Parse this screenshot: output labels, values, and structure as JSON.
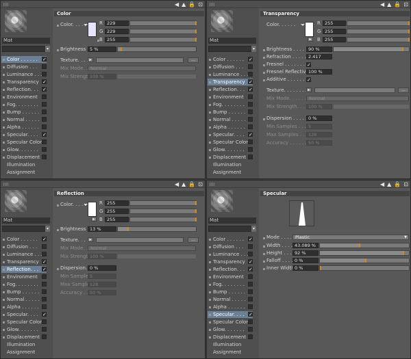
{
  "panels": [
    {
      "id": "color",
      "material_name": "Mat",
      "section_title": "Color",
      "selected_channel": 0,
      "channels": [
        {
          "label": "Color . . . . . .",
          "checked": true
        },
        {
          "label": "Diffusion . . .",
          "checked": false
        },
        {
          "label": "Luminance . . .",
          "checked": false
        },
        {
          "label": "Transparency",
          "checked": true
        },
        {
          "label": "Reflection. . .",
          "checked": true
        },
        {
          "label": "Environment",
          "checked": false
        },
        {
          "label": "Fog. . . . . . . .",
          "checked": false
        },
        {
          "label": "Bump . . . . . .",
          "checked": false
        },
        {
          "label": "Normal . . . . .",
          "checked": false
        },
        {
          "label": "Alpha . . . . . .",
          "checked": false
        },
        {
          "label": "Specular. . . .",
          "checked": true
        },
        {
          "label": "Specular Color",
          "checked": false
        },
        {
          "label": "Glow. . . . . . .",
          "checked": false
        },
        {
          "label": "Displacement",
          "checked": false
        },
        {
          "label": "Illumination",
          "checked": null
        },
        {
          "label": "Assignment",
          "checked": null
        }
      ]
    },
    {
      "id": "transparency",
      "material_name": "Mat",
      "section_title": "Transparency",
      "selected_channel": 3,
      "channels": [
        {
          "label": "Color . . . . . .",
          "checked": true
        },
        {
          "label": "Diffusion . . .",
          "checked": false
        },
        {
          "label": "Luminance . . .",
          "checked": false
        },
        {
          "label": "Transparency",
          "checked": true
        },
        {
          "label": "Reflection. . .",
          "checked": true
        },
        {
          "label": "Environment",
          "checked": false
        },
        {
          "label": "Fog. . . . . . . .",
          "checked": false
        },
        {
          "label": "Bump . . . . . .",
          "checked": false
        },
        {
          "label": "Normal . . . . .",
          "checked": false
        },
        {
          "label": "Alpha . . . . . .",
          "checked": false
        },
        {
          "label": "Specular. . . .",
          "checked": true
        },
        {
          "label": "Specular Color",
          "checked": false
        },
        {
          "label": "Glow. . . . . . .",
          "checked": false
        },
        {
          "label": "Displacement",
          "checked": false
        },
        {
          "label": "Illumination",
          "checked": null
        },
        {
          "label": "Assignment",
          "checked": null
        }
      ]
    },
    {
      "id": "reflection",
      "material_name": "Mat",
      "section_title": "Reflection",
      "selected_channel": 4,
      "channels": [
        {
          "label": "Color . . . . . .",
          "checked": true
        },
        {
          "label": "Diffusion . . .",
          "checked": false
        },
        {
          "label": "Luminance . . .",
          "checked": false
        },
        {
          "label": "Transparency",
          "checked": true
        },
        {
          "label": "Reflection. . .",
          "checked": true
        },
        {
          "label": "Environment",
          "checked": false
        },
        {
          "label": "Fog. . . . . . . .",
          "checked": false
        },
        {
          "label": "Bump . . . . . .",
          "checked": false
        },
        {
          "label": "Normal . . . . .",
          "checked": false
        },
        {
          "label": "Alpha . . . . . .",
          "checked": false
        },
        {
          "label": "Specular. . . .",
          "checked": true
        },
        {
          "label": "Specular Color",
          "checked": false
        },
        {
          "label": "Glow. . . . . . .",
          "checked": false
        },
        {
          "label": "Displacement",
          "checked": false
        },
        {
          "label": "Illumination",
          "checked": null
        },
        {
          "label": "Assignment",
          "checked": null
        }
      ]
    },
    {
      "id": "specular",
      "material_name": "Mat",
      "section_title": "Specular",
      "selected_channel": 10,
      "channels": [
        {
          "label": "Color . . . . . .",
          "checked": true
        },
        {
          "label": "Diffusion . . .",
          "checked": false
        },
        {
          "label": "Luminance . . .",
          "checked": false
        },
        {
          "label": "Transparency",
          "checked": true
        },
        {
          "label": "Reflection. . .",
          "checked": true
        },
        {
          "label": "Environment",
          "checked": false
        },
        {
          "label": "Fog. . . . . . . .",
          "checked": false
        },
        {
          "label": "Bump . . . . . .",
          "checked": false
        },
        {
          "label": "Normal . . . . .",
          "checked": false
        },
        {
          "label": "Alpha . . . . . .",
          "checked": false
        },
        {
          "label": "Specular. . . .",
          "checked": true
        },
        {
          "label": "Specular Color",
          "checked": false
        },
        {
          "label": "Glow. . . . . . .",
          "checked": false
        },
        {
          "label": "Displacement",
          "checked": false
        },
        {
          "label": "Illumination",
          "checked": null
        },
        {
          "label": "Assignment",
          "checked": null
        }
      ]
    }
  ],
  "color": {
    "color_label": "Color. . . . . .",
    "r": "229",
    "g": "229",
    "b": "255",
    "r_level": 0.898,
    "g_level": 0.898,
    "b_level": 1.0,
    "brightness_label": "Brightness",
    "brightness": "5 %",
    "brightness_level": 0.05,
    "texture_label": "Texture. . . . .",
    "mixmode_label": "Mix Mode. . . .",
    "mixmode_value": "Normal",
    "mixstrength_label": "Mix Strength",
    "mixstrength_value": "100 %"
  },
  "transparency": {
    "color_label": "Color. . . . . .",
    "r": "255",
    "g": "255",
    "b": "255",
    "brightness_label": "Brightness . . . . . . .",
    "brightness": "90 %",
    "brightness_level": 0.9,
    "refraction_label": "Refraction . . . . . . .",
    "refraction": "2.417",
    "fresnel_label": "Fresnel . . . . . . . . .",
    "fresnel_reflectivity_label": "Fresnel Reflectivity",
    "fresnel_reflectivity": "100 %",
    "additive_label": "Additive . . . . . . . .",
    "texture_label": "Texture. . . . . . . .",
    "mixmode_label": "Mix Mode. . . . . . .",
    "mixmode_value": "Normal",
    "mixstrength_label": "Mix Strength. . . . .",
    "mixstrength_value": "100 %",
    "dispersion_label": "Dispersion . . . . . .",
    "dispersion": "0 %",
    "minsamples_label": "Min Samples . . . .",
    "minsamples": "5",
    "maxsamples_label": "Max Samples . . . .",
    "maxsamples": "128",
    "accuracy_label": "Accuracy . . . . . .",
    "accuracy": "50 %"
  },
  "reflection": {
    "color_label": "Color. . . . . .",
    "r": "255",
    "g": "255",
    "b": "255",
    "brightness_label": "Brightness",
    "brightness": "13 %",
    "brightness_level": 0.13,
    "texture_label": "Texture. . . . .",
    "mixmode_label": "Mix Mode. . . .",
    "mixmode_value": "Normal",
    "mixstrength_label": "Mix Strength",
    "mixstrength_value": "100 %",
    "dispersion_label": "Dispersion. . .",
    "dispersion": "0 %",
    "minsamples_label": "Min Samples",
    "minsamples": "5",
    "maxsamples_label": "Max Samples",
    "maxsamples": "128",
    "accuracy_label": "Accuracy . . .",
    "accuracy": "50 %"
  },
  "specular": {
    "mode_label": "Mode . . . . . .",
    "mode_value": "Plastic",
    "width_label": "Width . . . . . .",
    "width": "43.089 %",
    "width_level": 0.43,
    "height_label": "Height . . . . .",
    "height": "92 %",
    "height_level": 0.92,
    "falloff_label": "Falloff . . . . .",
    "falloff": "0 %",
    "falloff_level": 0.0,
    "innerwidth_label": "Inner Width . .",
    "innerwidth": "0 %",
    "innerwidth_level": 0.0
  },
  "ui": {
    "swatch_color": "#e5e5ff",
    "white": "#ffffff",
    "accent_marker": "#d08a22"
  }
}
